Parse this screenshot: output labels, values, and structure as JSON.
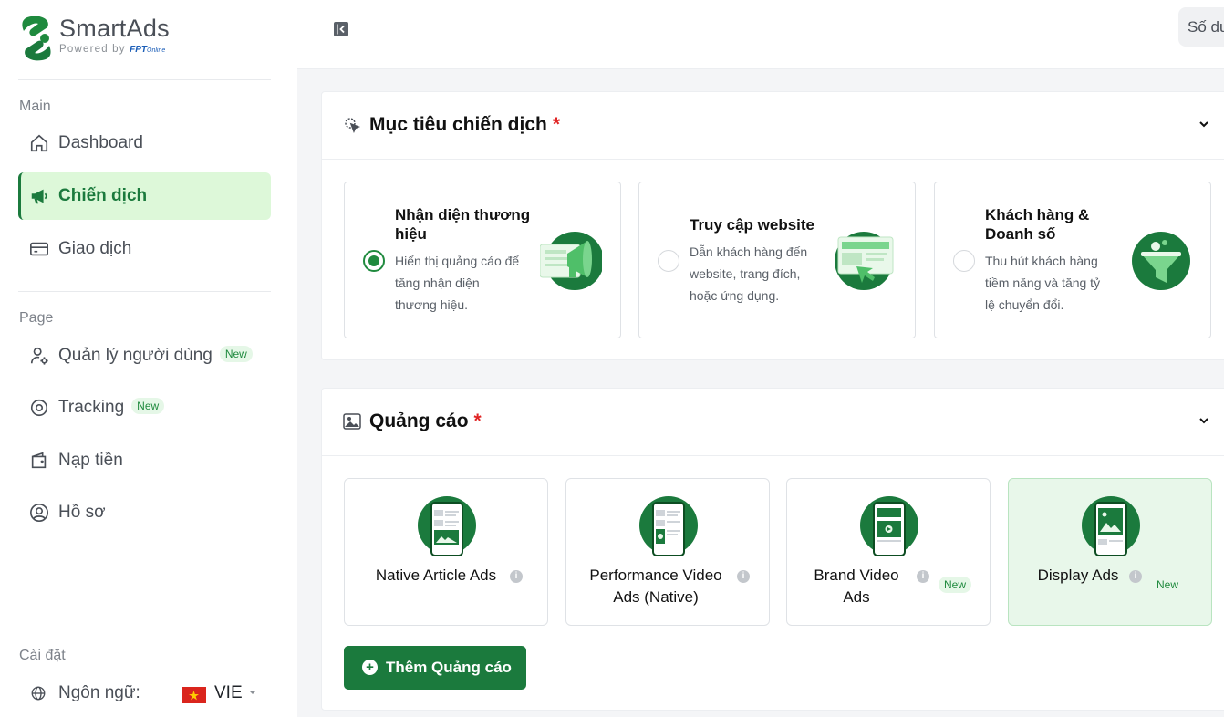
{
  "brand": {
    "name": "SmartAds",
    "powered_by": "Powered by",
    "partner_fpt": "FPT",
    "partner_online": "Online",
    "primary_color": "#1b7a3d"
  },
  "sidebar": {
    "sections": [
      {
        "title": "Main"
      },
      {
        "title": "Page"
      },
      {
        "title": "Cài đặt"
      }
    ],
    "items": [
      {
        "label": "Dashboard",
        "icon": "home-icon"
      },
      {
        "label": "Chiến dịch",
        "icon": "megaphone-icon",
        "active": true
      },
      {
        "label": "Giao dịch",
        "icon": "card-icon"
      },
      {
        "label": "Quản lý người dùng",
        "icon": "user-settings-icon",
        "badge": "New"
      },
      {
        "label": "Tracking",
        "icon": "target-icon",
        "badge": "New"
      },
      {
        "label": "Nạp tiền",
        "icon": "wallet-icon"
      },
      {
        "label": "Hồ sơ",
        "icon": "profile-icon"
      }
    ],
    "language": {
      "label": "Ngôn ngữ:",
      "code": "VIE",
      "flag": "vietnam-flag-icon"
    }
  },
  "topbar": {
    "balance_label": "Số dư"
  },
  "objective": {
    "title": "Mục tiêu chiến dịch",
    "required_mark": "*",
    "options": [
      {
        "title": "Nhận diện thương hiệu",
        "desc": "Hiển thị quảng cáo để tăng nhận diện thương hiệu.",
        "selected": true
      },
      {
        "title": "Truy cập website",
        "desc": "Dẫn khách hàng đến website, trang đích, hoặc ứng dụng.",
        "selected": false
      },
      {
        "title": "Khách hàng & Doanh số",
        "desc": "Thu hút khách hàng tiềm năng và tăng tỷ lệ chuyển đổi.",
        "selected": false
      }
    ]
  },
  "ads": {
    "title": "Quảng cáo",
    "required_mark": "*",
    "types": [
      {
        "name": "Native Article Ads",
        "info": "i"
      },
      {
        "name": "Performance Video Ads (Native)",
        "info": "i"
      },
      {
        "name": "Brand Video Ads",
        "info": "i",
        "badge": "New"
      },
      {
        "name": "Display Ads",
        "info": "i",
        "badge": "New",
        "selected": true
      }
    ],
    "add_label": "Thêm Quảng cáo",
    "add_icon": "+"
  }
}
